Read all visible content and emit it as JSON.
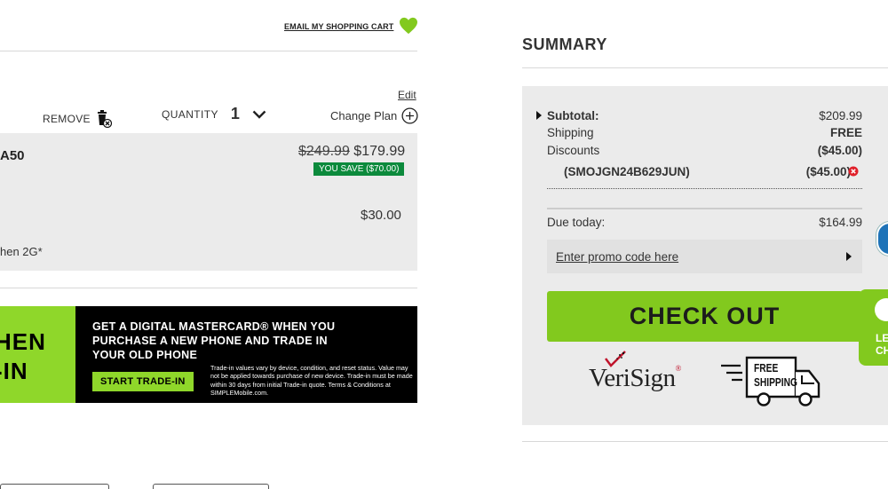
{
  "header": {
    "email_cart_label": "EMAIL MY SHOPPING CART"
  },
  "cart_item": {
    "edit_label": "Edit",
    "remove_label": "REMOVE",
    "quantity_label": "QUANTITY",
    "quantity_value": "1",
    "change_plan_label": "Change Plan",
    "model_name": "A50",
    "original_price": "$249.99",
    "sale_price": "$179.99",
    "you_save": "YOU SAVE ($70.00)",
    "plan_price": "$30.00",
    "plan_name": "hen 2G*"
  },
  "banner": {
    "big_line1": "HEN",
    "big_line2": "-IN",
    "headline": "GET A DIGITAL MASTERCARD® WHEN YOU PURCHASE A NEW PHONE AND TRADE IN YOUR OLD PHONE",
    "button_label": "START TRADE-IN",
    "fine_print": "Trade-in values vary by device, condition, and reset status. Value may not be applied towards purchase of new device. Trade-in must be made within 30 days from initial Trade-in quote. Terms & Conditions at SIMPLEMobile.com."
  },
  "summary": {
    "title": "SUMMARY",
    "subtotal_label": "Subtotal:",
    "subtotal_value": "$209.99",
    "shipping_label": "Shipping",
    "shipping_value": "FREE",
    "discounts_label": "Discounts",
    "discounts_value": "($45.00)",
    "promo_code": "(SMOJGN24B629JUN)",
    "promo_code_value": "($45.00)",
    "due_today_label": "Due today:",
    "due_today_value": "$164.99",
    "promo_placeholder": "Enter promo code here",
    "checkout_label": "CHECK OUT",
    "verisign_label": "VeriSign",
    "free_shipping_line1": "FREE",
    "free_shipping_line2": "SHIPPING"
  },
  "chat": {
    "line1": "LE",
    "line2": "CH"
  },
  "colors": {
    "accent_green": "#82c91e",
    "save_green": "#0c8a3c",
    "remove_red": "#e0202a"
  }
}
